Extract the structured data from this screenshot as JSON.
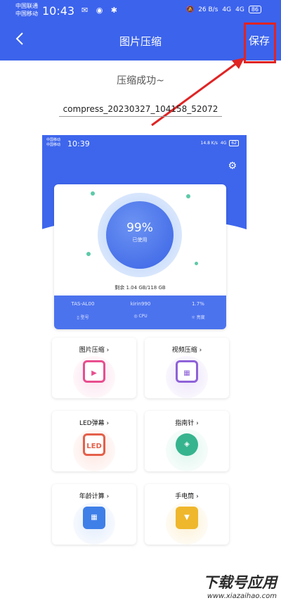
{
  "status": {
    "carrier_1": "中国联通",
    "carrier_2": "中国移动",
    "time": "10:43",
    "left_icons": "✉ ◉ ✱",
    "right_icons": [
      "🔕",
      "26 B/s",
      "4G",
      "4G",
      "86"
    ]
  },
  "header": {
    "back_icon": "chevron-left-icon",
    "title": "图片压缩",
    "save_label": "保存"
  },
  "result": {
    "success_text": "压缩成功~",
    "filename": "compress_20230327_104158_52072"
  },
  "inner": {
    "status": {
      "carrier_1": "中国移动",
      "carrier_2": "中国移动",
      "time": "10:39",
      "right_icons": [
        "14.8 K/s",
        "4G",
        "62"
      ]
    },
    "settings_icon": "gear-icon",
    "usage_percent": "99%",
    "usage_label": "已使用",
    "remaining": "剩余 1.04 GB/118 GB",
    "specs": [
      {
        "value": "TAS-AL00",
        "label": "型号"
      },
      {
        "value": "kirin990",
        "label": "CPU"
      },
      {
        "value": "1.7%",
        "label": "亮度"
      }
    ],
    "tiles": [
      {
        "label": "图片压缩 ›",
        "icon": "play-icon",
        "glyph": "▶",
        "color": "#e84e8f"
      },
      {
        "label": "视频压缩 ›",
        "icon": "image-icon",
        "glyph": "▦",
        "color": "#8e62d8"
      },
      {
        "label": "LED弹幕 ›",
        "icon": "led-icon",
        "glyph": "LED",
        "color": "#e4604a"
      },
      {
        "label": "指南针 ›",
        "icon": "compass-icon",
        "glyph": "◈",
        "color": "#36b48e"
      },
      {
        "label": "年龄计算 ›",
        "icon": "calculator-icon",
        "glyph": "▦",
        "color": "#3f7fe8"
      },
      {
        "label": "手电筒 ›",
        "icon": "flashlight-icon",
        "glyph": "▼",
        "color": "#efb72c"
      }
    ]
  },
  "watermark": {
    "brand": "下载号应用",
    "url": "www.xiazaihao.com"
  },
  "colors": {
    "brand_blue": "#3c63ec",
    "highlight_red": "#e02424"
  }
}
